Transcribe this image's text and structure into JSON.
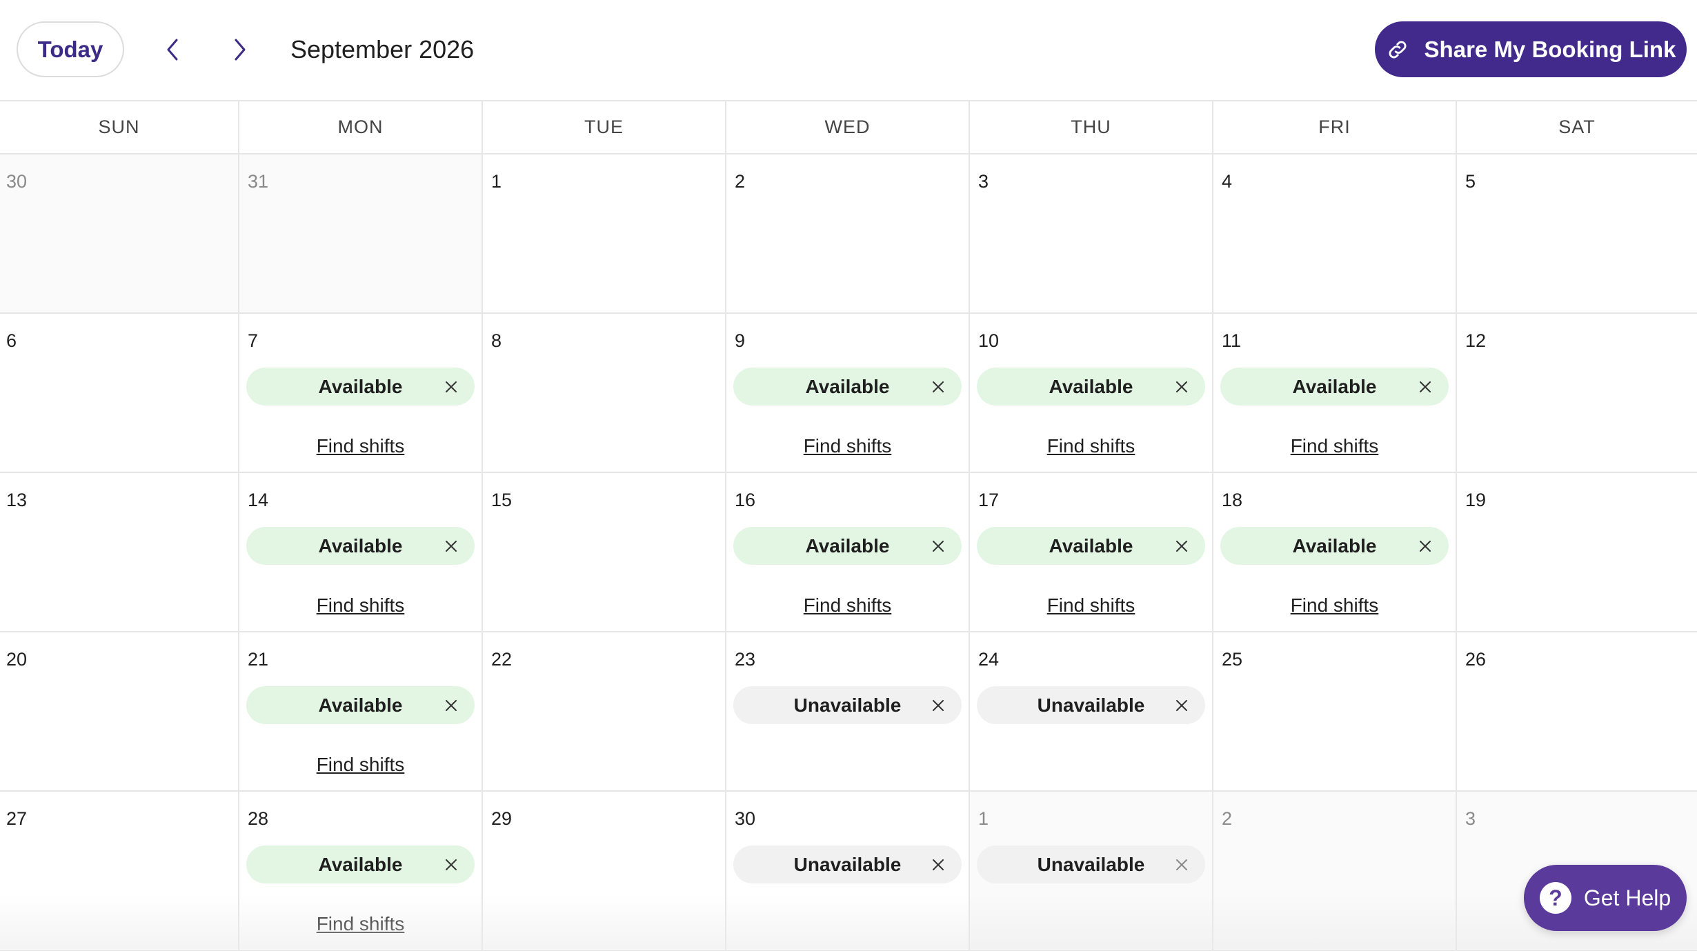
{
  "toolbar": {
    "today_label": "Today",
    "month_title": "September 2026",
    "share_label": "Share My Booking Link"
  },
  "calendar": {
    "weekdays": [
      "SUN",
      "MON",
      "TUE",
      "WED",
      "THU",
      "FRI",
      "SAT"
    ],
    "find_shifts_label": "Find shifts",
    "weeks": [
      [
        {
          "day": "30",
          "other": true
        },
        {
          "day": "31",
          "other": true
        },
        {
          "day": "1"
        },
        {
          "day": "2"
        },
        {
          "day": "3"
        },
        {
          "day": "4"
        },
        {
          "day": "5"
        }
      ],
      [
        {
          "day": "6"
        },
        {
          "day": "7",
          "status": "Available",
          "find": true
        },
        {
          "day": "8"
        },
        {
          "day": "9",
          "status": "Available",
          "find": true
        },
        {
          "day": "10",
          "status": "Available",
          "find": true
        },
        {
          "day": "11",
          "status": "Available",
          "find": true
        },
        {
          "day": "12"
        }
      ],
      [
        {
          "day": "13"
        },
        {
          "day": "14",
          "status": "Available",
          "find": true
        },
        {
          "day": "15"
        },
        {
          "day": "16",
          "status": "Available",
          "find": true
        },
        {
          "day": "17",
          "status": "Available",
          "find": true
        },
        {
          "day": "18",
          "status": "Available",
          "find": true
        },
        {
          "day": "19"
        }
      ],
      [
        {
          "day": "20"
        },
        {
          "day": "21",
          "status": "Available",
          "find": true
        },
        {
          "day": "22"
        },
        {
          "day": "23",
          "status": "Unavailable"
        },
        {
          "day": "24",
          "status": "Unavailable"
        },
        {
          "day": "25"
        },
        {
          "day": "26"
        }
      ],
      [
        {
          "day": "27"
        },
        {
          "day": "28",
          "status": "Available",
          "find": true
        },
        {
          "day": "29"
        },
        {
          "day": "30",
          "status": "Unavailable"
        },
        {
          "day": "1",
          "other": true,
          "status": "Unavailable"
        },
        {
          "day": "2",
          "other": true
        },
        {
          "day": "3",
          "other": true
        }
      ]
    ]
  },
  "help": {
    "label": "Get Help",
    "icon_glyph": "?"
  },
  "colors": {
    "brand": "#412a8c",
    "available_bg": "#e3f6e3",
    "unavailable_bg": "#f1f1f1",
    "help_bg": "#5a3a9a"
  },
  "icons": {
    "prev": "chevron-left-icon",
    "next": "chevron-right-icon",
    "share": "link-icon",
    "remove": "close-icon",
    "help": "question-icon"
  }
}
